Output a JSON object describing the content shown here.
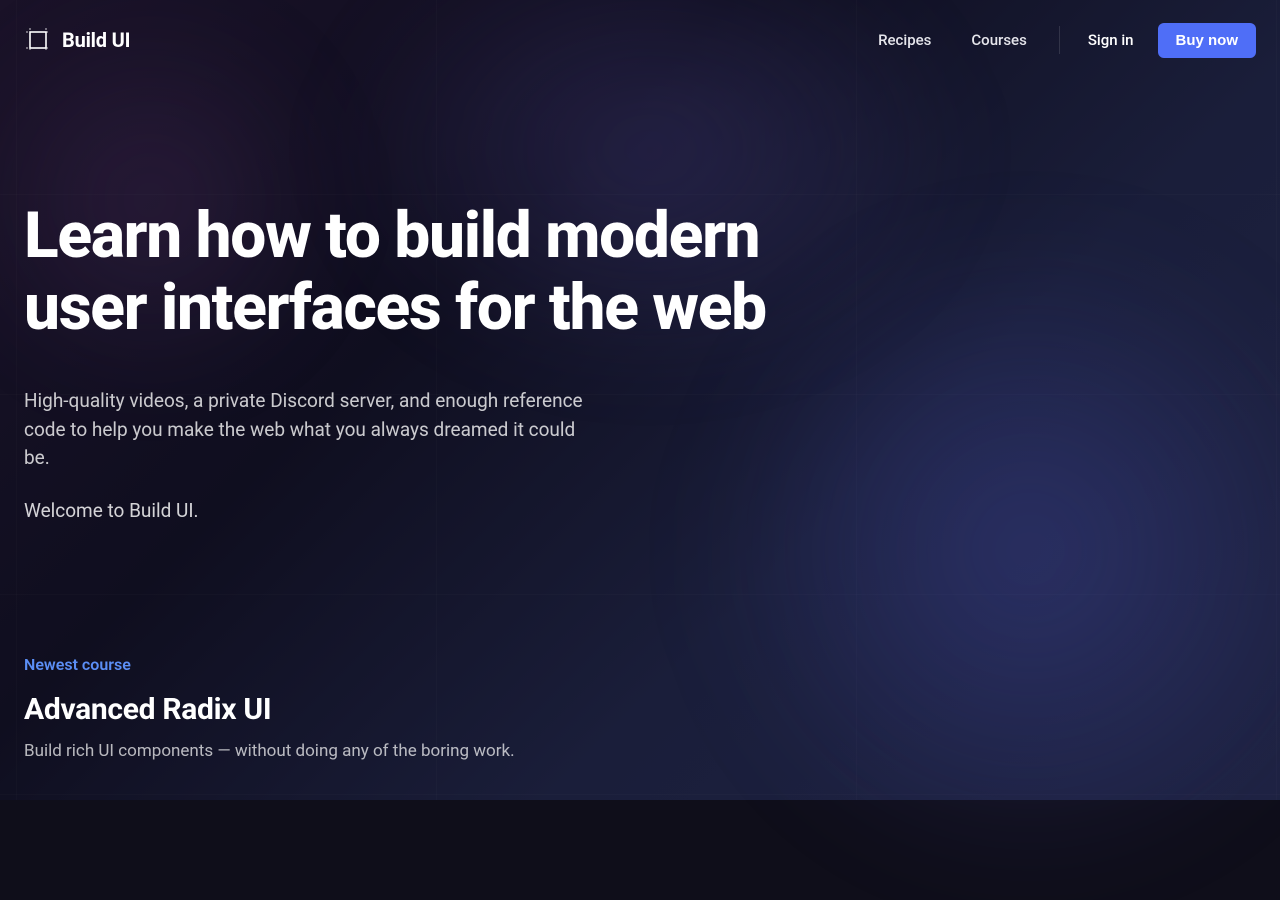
{
  "header": {
    "logo_text": "Build UI",
    "nav": {
      "recipes": "Recipes",
      "courses": "Courses"
    },
    "sign_in": "Sign in",
    "buy_now": "Buy now"
  },
  "hero": {
    "title": "Learn how to build modern user interfaces for the web",
    "subtitle": "High-quality videos, a private Discord server, and enough reference code to help you make the web what you always dreamed it could be.",
    "welcome": "Welcome to Build UI."
  },
  "course": {
    "label": "Newest course",
    "title": "Advanced Radix UI",
    "description": "Build rich UI components — without doing any of the boring work."
  },
  "colors": {
    "accent": "#4f6ef7",
    "link_blue": "#5b8ef5"
  }
}
